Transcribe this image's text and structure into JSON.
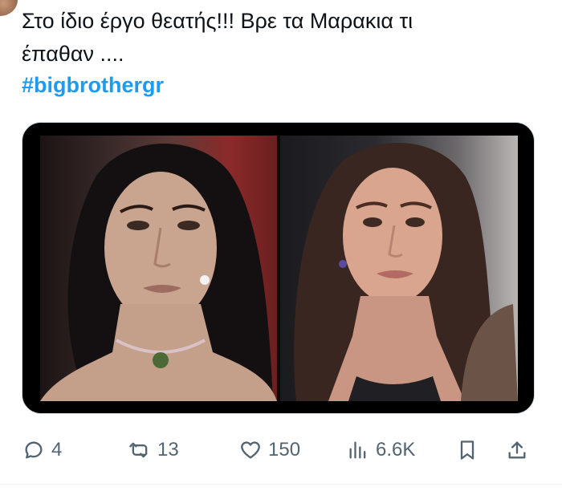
{
  "tweet": {
    "text_lines": [
      "Στο ίδιο έργο θεατής!!! Βρε τα Μαρακια τι",
      "έπαθαν ...."
    ],
    "hashtag": "#bigbrothergr"
  },
  "media": {
    "images": [
      {
        "name": "left-frame",
        "semantic": "woman-with-dark-hair-choker-photo"
      },
      {
        "name": "right-frame",
        "semantic": "woman-with-long-brown-hair-photo"
      }
    ]
  },
  "actions": {
    "reply": {
      "icon": "reply-icon",
      "count": "4"
    },
    "retweet": {
      "icon": "retweet-icon",
      "count": "13"
    },
    "like": {
      "icon": "heart-icon",
      "count": "150"
    },
    "views": {
      "icon": "views-icon",
      "count": "6.6K"
    },
    "bookmark": {
      "icon": "bookmark-icon"
    },
    "share": {
      "icon": "share-icon"
    }
  },
  "colors": {
    "text": "#0f1419",
    "link": "#1d9bf0",
    "muted": "#536471",
    "border": "#cfd9de",
    "divider": "#eff3f4"
  }
}
